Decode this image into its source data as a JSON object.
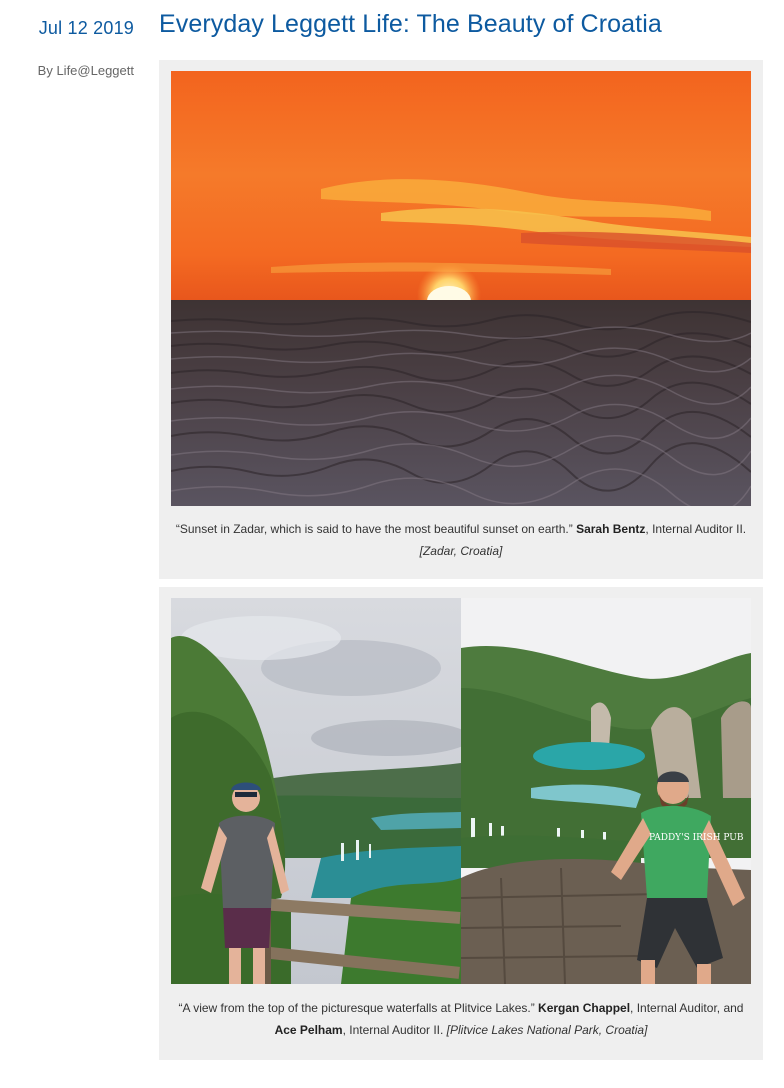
{
  "post": {
    "date": "Jul 12 2019",
    "author": "By Life@Leggett",
    "title": "Everyday Leggett Life: The Beauty of Croatia"
  },
  "figures": [
    {
      "caption": {
        "quote": "“Sunset in Zadar, which is said to have the most beautiful sunset on earth.” ",
        "name": "Sarah Bentz",
        "role": ", Internal Auditor II. ",
        "location": "[Zadar, Croatia]"
      }
    },
    {
      "caption": {
        "quote": "“A view from the top of the picturesque waterfalls at Plitvice Lakes.” ",
        "name1": "Kergan Chappel",
        "role1": ", Internal Auditor, and ",
        "name2": "Ace Pelham",
        "role2": ", Internal Auditor II. ",
        "location": "[Plitvice Lakes National Park, Croatia]"
      }
    }
  ],
  "images": {
    "sunset_shirt_text": "",
    "right_shirt_text": "PADDY'S IRISH PUB"
  },
  "colors": {
    "accent": "#0d5aa0",
    "figure_bg": "#efefef"
  }
}
